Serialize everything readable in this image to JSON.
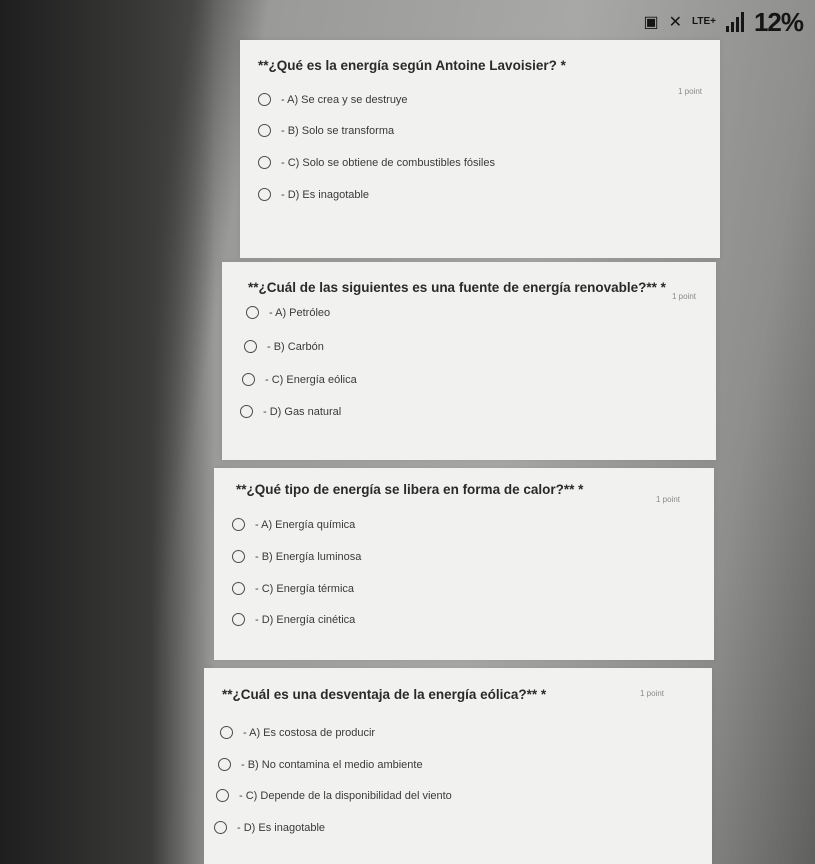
{
  "status": {
    "network": "LTE+",
    "battery": "12%",
    "icons": [
      "notification-icon",
      "mute-icon",
      "signal-icon"
    ]
  },
  "questions": [
    {
      "title": "**¿Qué es la energía según Antoine Lavoisier? *",
      "points": "1 point",
      "options": [
        "- A) Se crea y se destruye",
        "- B) Solo se transforma",
        "- C) Solo se obtiene de combustibles fósiles",
        "- D) Es inagotable"
      ]
    },
    {
      "title": "**¿Cuál de las siguientes es una fuente de energía renovable?** *",
      "points": "1 point",
      "options": [
        "- A) Petróleo",
        "- B) Carbón",
        "- C) Energía eólica",
        "- D) Gas natural"
      ]
    },
    {
      "title": "**¿Qué tipo de energía se libera en forma de calor?** *",
      "points": "1 point",
      "options": [
        "- A) Energía química",
        "- B) Energía luminosa",
        "- C) Energía térmica",
        "- D) Energía cinética"
      ]
    },
    {
      "title": "**¿Cuál es una desventaja de la energía eólica?** *",
      "points": "1 point",
      "options": [
        "- A) Es costosa de producir",
        "- B) No contamina el medio ambiente",
        "- C) Depende de la disponibilidad del viento",
        "- D) Es inagotable"
      ]
    }
  ]
}
